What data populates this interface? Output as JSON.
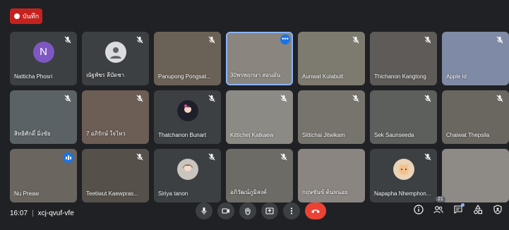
{
  "record": {
    "label": "บันทึก"
  },
  "participants": [
    {
      "name": "Natticha Phosri",
      "muted": true,
      "avatar_letter": "N",
      "bg": "#3c4043"
    },
    {
      "name": "ณัฐพัชร ลีบัดชา",
      "muted": true,
      "avatar_letter": "",
      "bg": "#3c4043"
    },
    {
      "name": "Panupong Pongsat...",
      "muted": true,
      "avatar_letter": "",
      "bg": "#6b6257"
    },
    {
      "name": "30พรพฤกษา สอนมั่น",
      "muted": false,
      "avatar_letter": "",
      "bg": "#8a857e"
    },
    {
      "name": "Aunwat Kulabutt",
      "muted": true,
      "avatar_letter": "",
      "bg": "#7d7a70"
    },
    {
      "name": "Thichanon Kangtong",
      "muted": true,
      "avatar_letter": "",
      "bg": "#5e5b58"
    },
    {
      "name": "Apple ld",
      "muted": true,
      "avatar_letter": "",
      "bg": "#7f8aa6"
    },
    {
      "name": "สิทธิศักดิ์ มิ่งขัย",
      "muted": true,
      "avatar_letter": "",
      "bg": "#5a6266"
    },
    {
      "name": "7 อภิรักษ์ ใจไหว",
      "muted": true,
      "avatar_letter": "",
      "bg": "#6c5d55"
    },
    {
      "name": "Thatchanon Bunart",
      "muted": true,
      "avatar_letter": "",
      "bg": "#3c4043"
    },
    {
      "name": "Kittichet Katkaew",
      "muted": true,
      "avatar_letter": "",
      "bg": "#8c8a84"
    },
    {
      "name": "Sittichai Jitwikam",
      "muted": true,
      "avatar_letter": "",
      "bg": "#77746d"
    },
    {
      "name": "Sek Saunseeda",
      "muted": true,
      "avatar_letter": "",
      "bg": "#5c5f5b"
    },
    {
      "name": "Chaiwat Thepsila",
      "muted": true,
      "avatar_letter": "",
      "bg": "#6a6660"
    },
    {
      "name": "Nu Preaw",
      "muted": false,
      "avatar_letter": "",
      "bg": "#6a655f"
    },
    {
      "name": "Teetiwut Kaewpras...",
      "muted": true,
      "avatar_letter": "",
      "bg": "#55504a"
    },
    {
      "name": "Siriya tanon",
      "muted": true,
      "avatar_letter": "",
      "bg": "#3c4043"
    },
    {
      "name": "อภิวัฒน์ภูมิสงค์",
      "muted": true,
      "avatar_letter": "",
      "bg": "#6d6b66"
    },
    {
      "name": "กฤษขันข์ ต้นหน่อย",
      "muted": false,
      "avatar_letter": "",
      "bg": "#8a8580"
    },
    {
      "name": "Napapha Nhemphon...",
      "muted": true,
      "avatar_letter": "",
      "bg": "#3c4043"
    },
    {
      "name": "",
      "muted": false,
      "avatar_letter": "",
      "bg": "#8e8b86"
    }
  ],
  "meeting": {
    "time": "16:07",
    "separator": "|",
    "code": "xcj-qvuf-vfe"
  },
  "people_count": "21",
  "controls": [
    "mic-icon",
    "camera-icon",
    "raise-hand-icon",
    "present-icon",
    "more-icon",
    "end-call-icon"
  ],
  "right_icons": [
    "info-icon",
    "people-icon",
    "chat-icon",
    "activities-icon",
    "host-controls-icon"
  ],
  "colors": {
    "background": "#202124",
    "tile": "#3c4043",
    "end_call": "#ea4335",
    "record": "#c5221f",
    "accent": "#1a73e8"
  }
}
